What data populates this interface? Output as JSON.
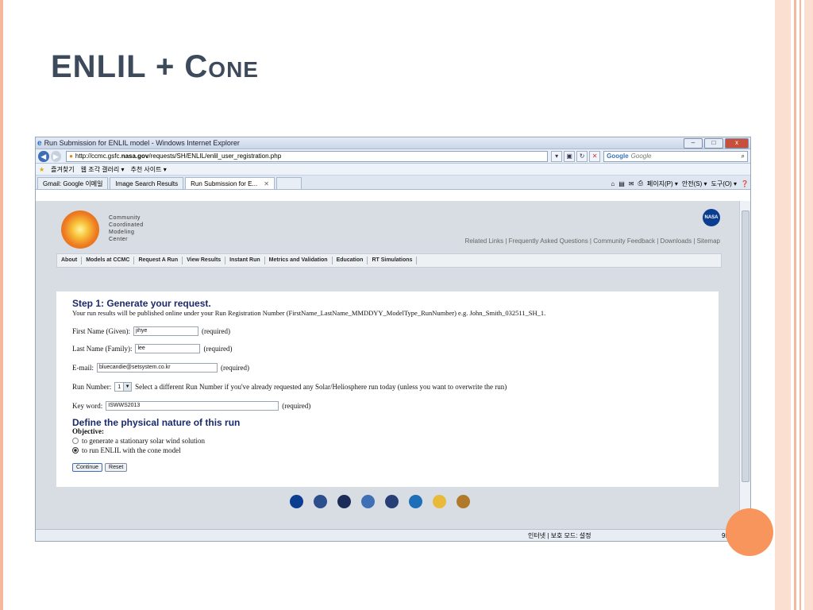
{
  "slide": {
    "title": "ENLIL + Cone"
  },
  "browser": {
    "window_title": "Run Submission for ENLIL model - Windows Internet Explorer",
    "address_prefix": "http://ccmc.gsfc.",
    "address_domain": "nasa.gov",
    "address_suffix": "/requests/SH/ENLIL/enlil_user_registration.php",
    "search_placeholder": "Google",
    "search_engine_label": "Google",
    "favorites_label": "즐겨찾기",
    "fav_items": [
      "웹 조각 갤러리 ▾",
      "추천 사이트 ▾"
    ],
    "tabs": [
      {
        "label": "Gmail: Google 이메일"
      },
      {
        "label": "Image Search Results"
      },
      {
        "label": "Run Submission for E...",
        "active": true
      }
    ],
    "command_items": [
      "페이지(P) ▾",
      "안전(S) ▾",
      "도구(O) ▾"
    ],
    "status_zone": "인터넷 | 보호 모드: 설정",
    "zoom": "95%",
    "window_buttons": {
      "minimize": "–",
      "maximize": "□",
      "close": "x"
    }
  },
  "ccmc": {
    "logo_lines": [
      "Community",
      "Coordinated",
      "Modeling",
      "Center"
    ],
    "header_links": "Related Links | Frequently Asked Questions | Community Feedback | Downloads | Sitemap",
    "nav_items": [
      "About",
      "Models at CCMC",
      "Request A Run",
      "View Results",
      "Instant Run",
      "Metrics and Validation",
      "Education",
      "RT Simulations"
    ],
    "nasa_badge": "NASA"
  },
  "form": {
    "step_title": "Step 1: Generate your request.",
    "intro": "Your run results will be published online under your Run Registration Number (FirstName_LastName_MMDDYY_ModelType_RunNumber) e.g. John_Smith_032511_SH_1.",
    "first_name_label": "First Name (Given):",
    "first_name_value": "jihye",
    "last_name_label": "Last Name (Family):",
    "last_name_value": "lee",
    "email_label": "E-mail:",
    "email_value": "bluecandie@setsystem.co.kr",
    "required": "(required)",
    "run_number_label": "Run Number:",
    "run_number_value": "1",
    "run_number_help": "Select a different Run Number if you've already requested any Solar/Heliosphere run today (unless you want to overwrite the run)",
    "keyword_label": "Key word:",
    "keyword_value": "ISWWS2013",
    "section_title": "Define the physical nature of this run",
    "objective_label": "Objective:",
    "objective_option_1": "to generate a stationary solar wind solution",
    "objective_option_2": "to run ENLIL with the cone model",
    "continue_button": "Continue",
    "reset_button": "Reset"
  }
}
